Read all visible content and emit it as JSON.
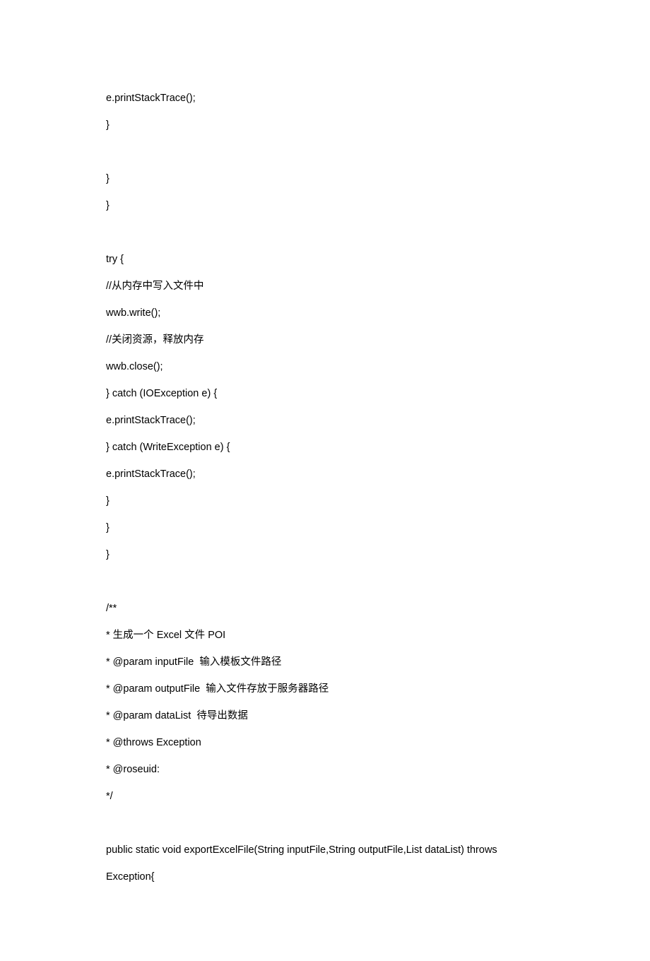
{
  "lines": [
    "e.printStackTrace();",
    "}",
    "",
    "}",
    "}",
    "",
    "try {",
    "//从内存中写入文件中",
    "wwb.write();",
    "//关闭资源，释放内存",
    "wwb.close();",
    "} catch (IOException e) {",
    "e.printStackTrace();",
    "} catch (WriteException e) {",
    "e.printStackTrace();",
    "}",
    "}",
    "}",
    "",
    "/**",
    "* 生成一个 Excel 文件 POI",
    "* @param inputFile  输入模板文件路径",
    "* @param outputFile  输入文件存放于服务器路径",
    "* @param dataList  待导出数据",
    "* @throws Exception",
    "* @roseuid:",
    "*/",
    "",
    "public static void exportExcelFile(String inputFile,String outputFile,List dataList) throws Exception{"
  ]
}
